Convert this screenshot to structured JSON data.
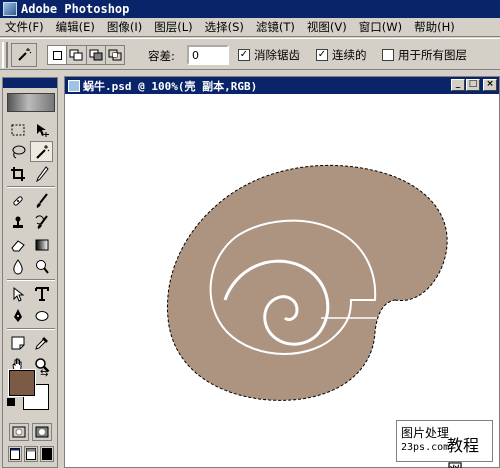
{
  "app": {
    "title": "Adobe Photoshop"
  },
  "menu": [
    "文件(F)",
    "编辑(E)",
    "图像(I)",
    "图层(L)",
    "选择(S)",
    "滤镜(T)",
    "视图(V)",
    "窗口(W)",
    "帮助(H)"
  ],
  "options": {
    "tool_icon": "magic-wand-icon",
    "tolerance_label": "容差:",
    "tolerance_value": "0",
    "antialias_label": "消除锯齿",
    "antialias_checked": true,
    "contiguous_label": "连续的",
    "contiguous_checked": true,
    "all_layers_label": "用于所有图层",
    "all_layers_checked": false
  },
  "tools": [
    "rectangular-marquee-icon",
    "move-icon",
    "lasso-icon",
    "magic-wand-icon",
    "crop-icon",
    "slice-icon",
    "healing-brush-icon",
    "brush-icon",
    "clone-stamp-icon",
    "history-brush-icon",
    "eraser-icon",
    "gradient-icon",
    "blur-icon",
    "dodge-icon",
    "path-selection-icon",
    "type-icon",
    "pen-icon",
    "ellipse-shape-icon",
    "notes-icon",
    "eyedropper-icon",
    "hand-icon",
    "zoom-icon"
  ],
  "active_tool": "magic-wand-icon",
  "colors": {
    "foreground": "#7b5b46",
    "background": "#ffffff",
    "shell": "#ad9480",
    "titlebar": "#0a246a"
  },
  "document": {
    "title": "蜗牛.psd @ 100%(壳 副本,RGB)"
  },
  "watermark": {
    "line1": "图片处理",
    "big": "教程网",
    "line2": "23ps.com"
  }
}
